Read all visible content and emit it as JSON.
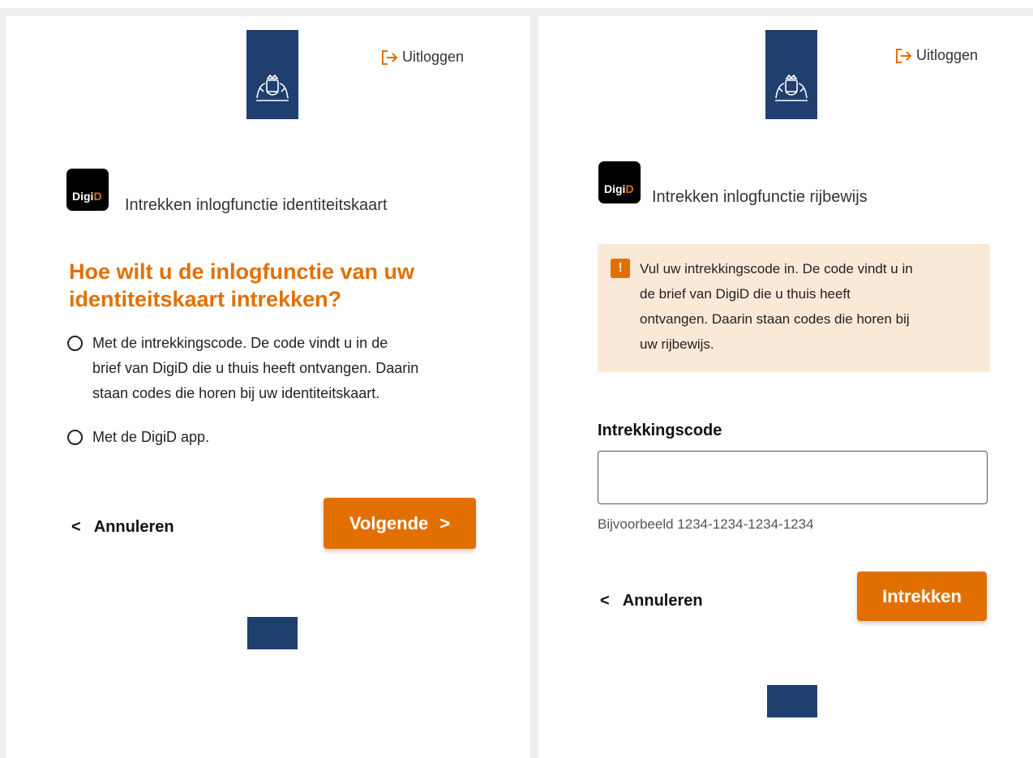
{
  "colors": {
    "accent": "#e17000",
    "brand_blue": "#1f3f6e",
    "alert_bg": "#fbe9d8"
  },
  "left": {
    "logout_label": "Uitloggen",
    "digid_badge": {
      "digi": "Digi",
      "d": "D"
    },
    "digid_title": "Intrekken inlogfunctie identiteitskaart",
    "heading_line1": "Hoe wilt u de inlogfunctie van uw",
    "heading_line2": "identiteitskaart intrekken?",
    "options": [
      {
        "line1": "Met de intrekkingscode. De code vindt u in de",
        "line2": "brief van DigiD die u thuis heeft ontvangen. Daarin",
        "line3": "staan codes die horen bij uw identiteitskaart."
      },
      {
        "line1": "Met de DigiD app."
      }
    ],
    "back_label": "Annuleren",
    "next_label": "Volgende"
  },
  "right": {
    "logout_label": "Uitloggen",
    "digid_badge": {
      "digi": "Digi",
      "d": "D"
    },
    "digid_title": "Intrekken inlogfunctie rijbewijs",
    "alert": {
      "icon_symbol": "!",
      "line1": "Vul uw intrekkingscode in. De code vindt u in",
      "line2": "de brief van DigiD die u thuis heeft",
      "line3": "ontvangen. Daarin staan codes die horen bij",
      "line4": "uw rijbewijs."
    },
    "field_label": "Intrekkingscode",
    "field_value": "",
    "field_hint": "Bijvoorbeeld 1234-1234-1234-1234",
    "back_label": "Annuleren",
    "submit_label": "Intrekken"
  }
}
